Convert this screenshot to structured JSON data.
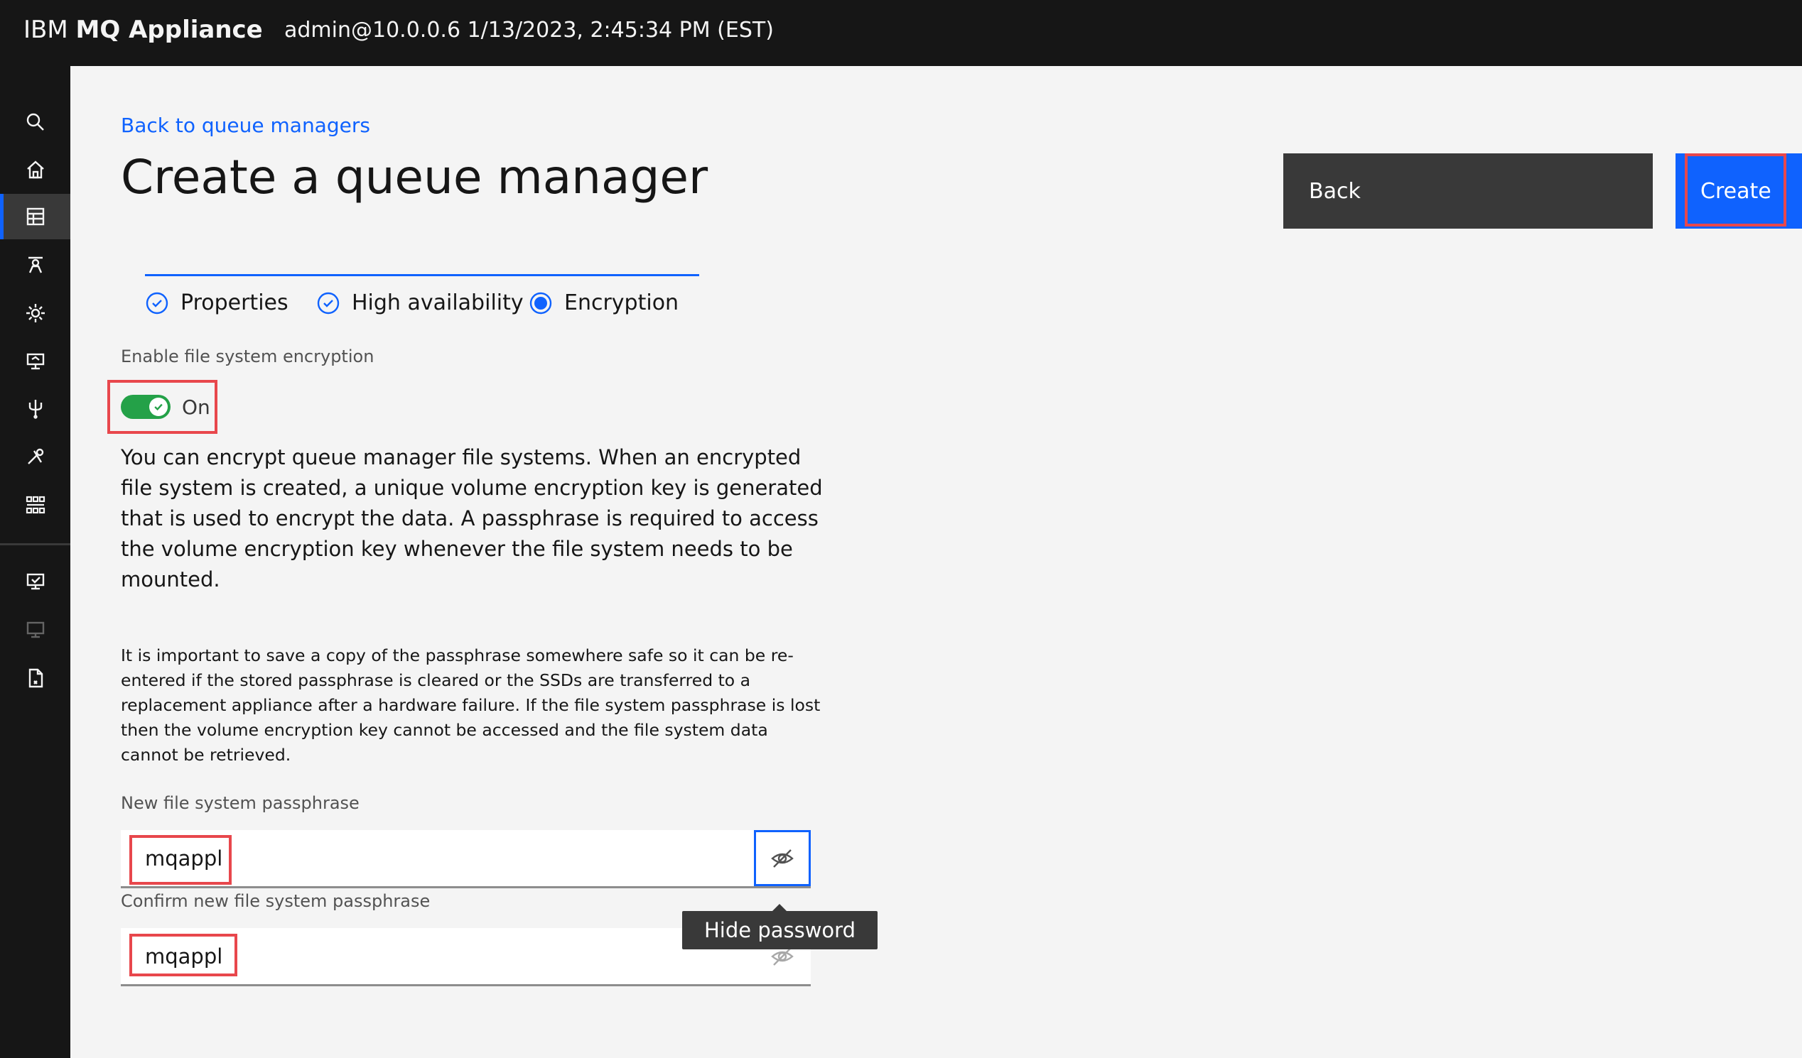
{
  "header": {
    "brand_prefix": "IBM ",
    "brand_name": "MQ Appliance",
    "session": "admin@10.0.0.6 1/13/2023, 2:45:34 PM (EST)"
  },
  "sidebar": {
    "items": [
      {
        "icon": "search-icon"
      },
      {
        "icon": "home-icon"
      },
      {
        "icon": "queue-managers-icon",
        "active": true
      },
      {
        "icon": "messaging-icon"
      },
      {
        "icon": "gear-icon"
      },
      {
        "icon": "network-icon"
      },
      {
        "icon": "usb-icon"
      },
      {
        "icon": "tools-icon"
      },
      {
        "icon": "grid-apps-icon"
      },
      {
        "icon": "monitor-check-icon"
      },
      {
        "icon": "monitor-disabled-icon"
      },
      {
        "icon": "file-icon"
      }
    ]
  },
  "page": {
    "back_link": "Back to queue managers",
    "title": "Create a queue manager",
    "back_button": "Back",
    "create_button": "Create"
  },
  "steps": [
    {
      "label": "Properties",
      "state": "complete"
    },
    {
      "label": "High availability",
      "state": "complete"
    },
    {
      "label": "Encryption",
      "state": "current"
    }
  ],
  "encryption": {
    "toggle_label": "Enable file system encryption",
    "toggle_state": "On",
    "description": "You can encrypt queue manager file systems. When an encrypted file system is created, a unique volume encryption key is generated that is used to encrypt the data. A passphrase is required to access the volume encryption key whenever the file system needs to be mounted.",
    "warning": "It is important to save a copy of the passphrase somewhere safe so it can be re-entered if the stored passphrase is cleared or the SSDs are transferred to a replacement appliance after a hardware failure. If the file system passphrase is lost then the volume encryption key cannot be accessed and the file system data cannot be retrieved.",
    "new_passphrase_label": "New file system passphrase",
    "new_passphrase_value": "mqappl",
    "confirm_passphrase_label": "Confirm new file system passphrase",
    "confirm_passphrase_value": "mqappl",
    "tooltip": "Hide password"
  },
  "colors": {
    "accent": "#0f62fe",
    "toggle_on": "#24a148",
    "highlight": "#e8474c",
    "header_bg": "#161616"
  }
}
